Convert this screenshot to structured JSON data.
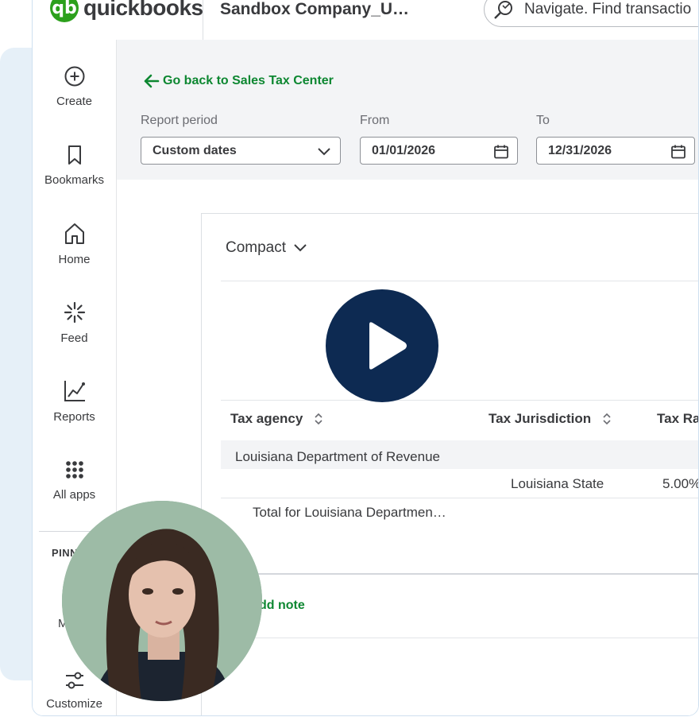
{
  "brand": {
    "mark": "qb",
    "name": "quickbooks"
  },
  "company_name": "Sandbox Company_U…",
  "search": {
    "placeholder": "Navigate. Find transactio"
  },
  "sidebar": {
    "items": [
      {
        "label": "Create",
        "icon": "plus-circle-icon"
      },
      {
        "label": "Bookmarks",
        "icon": "bookmark-icon"
      },
      {
        "label": "Home",
        "icon": "home-icon"
      },
      {
        "label": "Feed",
        "icon": "feed-icon"
      },
      {
        "label": "Reports",
        "icon": "reports-chart-icon"
      },
      {
        "label": "All apps",
        "icon": "apps-grid-icon"
      }
    ],
    "pinned_label": "PINN",
    "pinned_item_fragment": "M",
    "customize_label": "Customize"
  },
  "filters": {
    "back_link": "Go back to Sales Tax Center",
    "report_period_label": "Report period",
    "report_period_value": "Custom dates",
    "from_label": "From",
    "from_value": "01/01/2026",
    "to_label": "To",
    "to_value": "12/31/2026"
  },
  "report": {
    "view_label": "Compact",
    "columns": [
      "Tax agency",
      "Tax Jurisdiction",
      "Tax Ra"
    ],
    "group": "Louisiana Department of Revenue",
    "row": {
      "jurisdiction": "Louisiana State",
      "rate": "5.00%"
    },
    "total_label": "Total for Louisiana Departmen…",
    "add_note": "dd note"
  },
  "colors": {
    "brand_green": "#2ca01c",
    "link_green": "#0d8731",
    "play_button": "#0d2a52",
    "backdrop": "#e6f0f8"
  }
}
